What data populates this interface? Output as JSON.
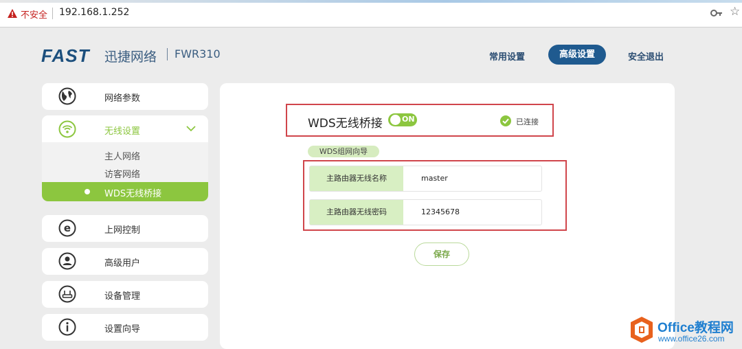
{
  "browser": {
    "insecure_label": "不安全",
    "url": "192.168.1.252"
  },
  "header": {
    "logo": "FAST",
    "brand_cn": "迅捷网络",
    "model": "FWR310",
    "nav": {
      "common": "常用设置",
      "advanced": "高级设置",
      "logout": "安全退出"
    }
  },
  "sidebar": {
    "items": [
      {
        "label": "网络参数",
        "icon": "globe-icon"
      },
      {
        "label": "无线设置",
        "icon": "wifi-icon",
        "expanded": true,
        "children": [
          "主人网络",
          "访客网络",
          "WDS无线桥接"
        ],
        "active_child": "WDS无线桥接"
      },
      {
        "label": "上网控制",
        "icon": "e-circle-icon"
      },
      {
        "label": "高级用户",
        "icon": "user-icon"
      },
      {
        "label": "设备管理",
        "icon": "router-icon"
      },
      {
        "label": "设置向导",
        "icon": "info-icon"
      }
    ]
  },
  "main": {
    "wds_title": "WDS无线桥接",
    "toggle_label": "ON",
    "status": "已连接",
    "wizard_tag": "WDS组网向导",
    "fields": [
      {
        "label": "主路由器无线名称",
        "value": "master"
      },
      {
        "label": "主路由器无线密码",
        "value": "12345678"
      }
    ],
    "save_label": "保存"
  },
  "watermark": {
    "title": "Office教程网",
    "url": "www.office26.com"
  },
  "colors": {
    "accent_green": "#8cc63f",
    "nav_blue": "#1f5a8f",
    "highlight_red": "#d0454b"
  }
}
